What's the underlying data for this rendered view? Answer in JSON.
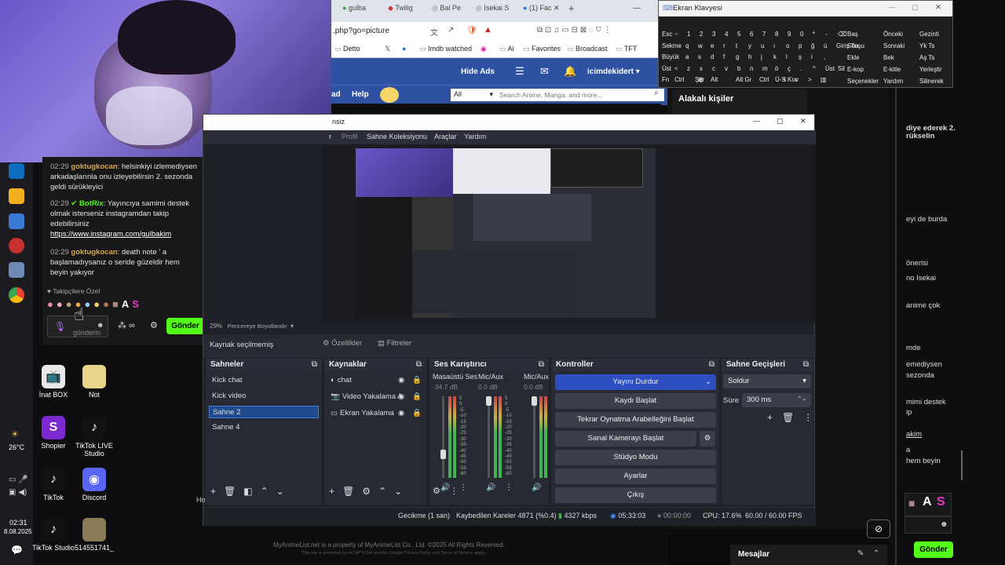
{
  "taskbar": {
    "weather": "26°C",
    "time": "02:31",
    "date": "8.08.2025"
  },
  "desktop_icons": [
    {
      "label": "İnat BOX",
      "color": "#e8e8e8",
      "glyph": "📺"
    },
    {
      "label": "Not",
      "color": "#e8d58a",
      "glyph": ""
    },
    {
      "label": "Shopier",
      "color": "#7b2ad1",
      "glyph": "S"
    },
    {
      "label": "TikTok LIVE Studio",
      "color": "#111",
      "glyph": "♪"
    },
    {
      "label": "TikTok",
      "color": "#111",
      "glyph": "♪"
    },
    {
      "label": "Discord",
      "color": "#5865f2",
      "glyph": "◉"
    },
    {
      "label": "TikTok Studio",
      "color": "#111",
      "glyph": "♪"
    },
    {
      "label": "514551741_",
      "color": "#8a7a55",
      "glyph": ""
    }
  ],
  "chat": {
    "messages": [
      {
        "time": "02:29",
        "user": "goktugkocan",
        "text": ": helsinkiyi izlemediysen arkadaşlarınla onu izleyebilirsin 2. sezonda geldi sürükleyici"
      },
      {
        "time": "02:29",
        "user": "BotRix",
        "text": ": Yayıncıya samimi destek olmak isterseniz instagramdan takip edebilirsiniz",
        "link": "https://www.instagram.com/gulbakim"
      },
      {
        "time": "02:29",
        "user": "goktugkocan",
        "text": ": death note ' a başlamadıysanız o seride güzeldir hem beyin yakıyor"
      }
    ],
    "followers_label": "Takipçilere Özel",
    "input_placeholder": "gönderin",
    "send_label": "Gönder"
  },
  "browser": {
    "tabs": [
      "gulba",
      "Twilig",
      "Bal Pe",
      "Isekai S",
      "(1) Fac"
    ],
    "address": ".php?go=picture",
    "bookmarks": [
      "Detto",
      "Imdb watched",
      "Ai",
      "Favorites",
      "Broadcast",
      "TFT"
    ]
  },
  "mal": {
    "hide_ads": "Hide Ads",
    "username": "icimdekidert",
    "nav": [
      "ad",
      "Help"
    ],
    "search_scope": "All",
    "search_placeholder": "Search Anime, Manga, and more...",
    "related_title": "Alakalı kişiler",
    "footer": "MyAnimeList.net is a property of MyAnimeList Co., Ltd. ©2025 All Rights Reserved.",
    "footer_small": "This site is protected by reCAPTCHA and the Google Privacy Policy and Terms of Service apply."
  },
  "right_page": {
    "lines": [
      "diye ederek 2.",
      "rükselin",
      "eyi de burda",
      "önerisi",
      "no Isekai",
      "anime çok",
      "mde",
      "emediysen",
      "sezonda",
      "mimi destek",
      "ip",
      "akim",
      "a",
      "hem beyin"
    ],
    "send_label": "Gönder",
    "messages_label": "Mesajlar"
  },
  "keyboard": {
    "title": "Ekran Klavyesi",
    "rows": [
      [
        "Esc",
        "~",
        "1",
        "2",
        "3",
        "4",
        "5",
        "6",
        "7",
        "8",
        "9",
        "0",
        "*",
        "-",
        "⌫"
      ],
      [
        "Sekme",
        "q",
        "w",
        "e",
        "r",
        "t",
        "y",
        "u",
        "ı",
        "o",
        "p",
        "ğ",
        "ü",
        "Giriş Tuşu"
      ],
      [
        "Büyük",
        "a",
        "s",
        "d",
        "f",
        "g",
        "h",
        "j",
        "k",
        "l",
        "ş",
        "i",
        ","
      ],
      [
        "Üst",
        "<",
        "z",
        "x",
        "c",
        "v",
        "b",
        "n",
        "m",
        "ö",
        "ç",
        ".",
        "^",
        "Üst",
        "Sil"
      ],
      [
        "Fn",
        "Ctrl",
        "⊞",
        "Alt",
        "",
        "Alt Gr",
        "Ctrl",
        "<",
        "v",
        ">",
        "▥"
      ]
    ],
    "right_col1": [
      "Baş",
      "Son",
      "Ekle",
      "E-kop",
      "Seçenekler"
    ],
    "right_col2": [
      "Önceki",
      "Sonraki",
      "Bek",
      "E-kitle",
      "Yardım"
    ],
    "right_col3": [
      "Gezinti",
      "Yk Ts",
      "Aş Ts",
      "Yerleştir",
      "Silinerek"
    ],
    "space_label": "Şçr",
    "misc": "Ü-S Kor"
  },
  "obs": {
    "title": "nsiz",
    "menu": [
      "r",
      "Profil",
      "Sahne Koleksiyonu",
      "Araçlar",
      "Yardım"
    ],
    "zoom": "29%",
    "zoom_label": "Pencereye Boyutlandır",
    "source_none": "Kaynak seçilmemiş",
    "properties": "Özellikler",
    "filters": "Filtreler",
    "scenes_title": "Sahneler",
    "scenes": [
      "Kick chat",
      "Kick video",
      "Sahne 2",
      "Sahne 4"
    ],
    "selected_scene": 2,
    "sources_title": "Kaynaklar",
    "sources": [
      "chat",
      "Video Yakalama A",
      "Ekran Yakalama"
    ],
    "mixer_title": "Ses Karıştırıcı",
    "mixer": [
      {
        "name": "Masaüstü Ses",
        "db": "-34.7 dB",
        "level": 0.35
      },
      {
        "name": "Mic/Aux",
        "db": "0.0 dB",
        "level": 0.0
      },
      {
        "name": "Mic/Aux",
        "db": "0.0 dB",
        "level": 0.0
      }
    ],
    "db_ticks": [
      "5",
      "0",
      "-5",
      "-10",
      "-15",
      "-20",
      "-25",
      "-30",
      "-35",
      "-40",
      "-45",
      "-50",
      "-55",
      "-60"
    ],
    "controls_title": "Kontroller",
    "controls": [
      "Yayını Durdur",
      "Kaydı Başlat",
      "Tekrar Oynatma Arabelleğini Başlat",
      "Sanal Kamerayı Başlat",
      "Stüdyo Modu",
      "Ayarlar",
      "Çıkış"
    ],
    "transitions_title": "Sahne Geçişleri",
    "transition": "Soldur",
    "duration_label": "Süre",
    "duration": "300 ms",
    "status": {
      "delay": "Gecikme (1 san)",
      "dropped": "Kaybedilen Kareler 4871 (%0.4)",
      "kbps": "4327 kbps",
      "live": "05:33:03",
      "rec": "00:00:00",
      "cpu": "CPU: 17.6%",
      "fps": "60.00 / 60.00 FPS"
    },
    "left_edge": "Ho"
  }
}
